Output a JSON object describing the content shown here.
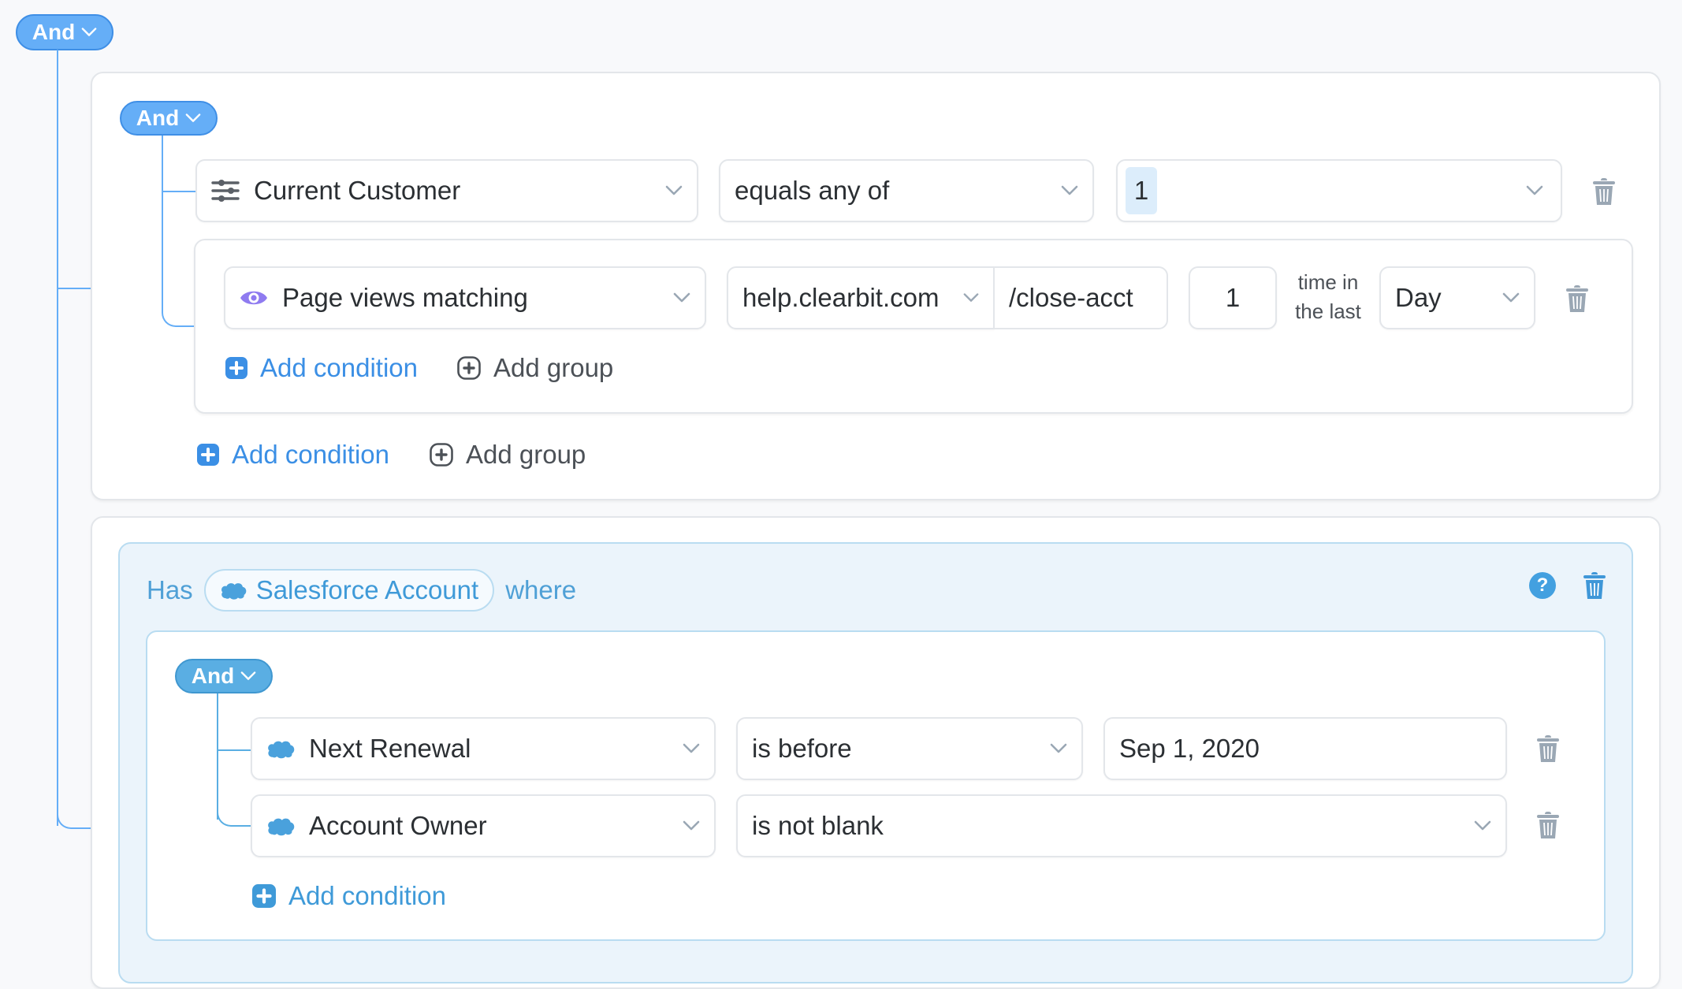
{
  "root": {
    "operator": "And",
    "group1": {
      "operator": "And",
      "condition": {
        "field": "Current Customer",
        "field_icon": "sliders-icon",
        "operator": "equals any of",
        "values": [
          "1"
        ]
      },
      "nested_group": {
        "condition": {
          "field": "Page views matching",
          "field_icon": "eye-icon",
          "domain": "help.clearbit.com",
          "path": "/close-acct",
          "count": "1",
          "time_label_line1": "time in",
          "time_label_line2": "the last",
          "period": "Day"
        },
        "add_condition_label": "Add condition",
        "add_group_label": "Add group"
      },
      "add_condition_label": "Add condition",
      "add_group_label": "Add group"
    },
    "group2": {
      "has_label": "Has",
      "object": "Salesforce Account",
      "object_icon": "salesforce-cloud-icon",
      "where_label": "where",
      "help_icon": "question-circle-icon",
      "inner": {
        "operator": "And",
        "conditions": [
          {
            "field": "Next Renewal",
            "operator": "is before",
            "value": "Sep 1, 2020"
          },
          {
            "field": "Account Owner",
            "operator": "is not blank"
          }
        ],
        "add_condition_label": "Add condition"
      }
    }
  },
  "colors": {
    "accent": "#65aef7",
    "salesforce": "#5aaee3",
    "link_blue": "#3b8fe5",
    "eye_purple": "#8f7bf0",
    "trash_gray": "#9aa7b4"
  }
}
